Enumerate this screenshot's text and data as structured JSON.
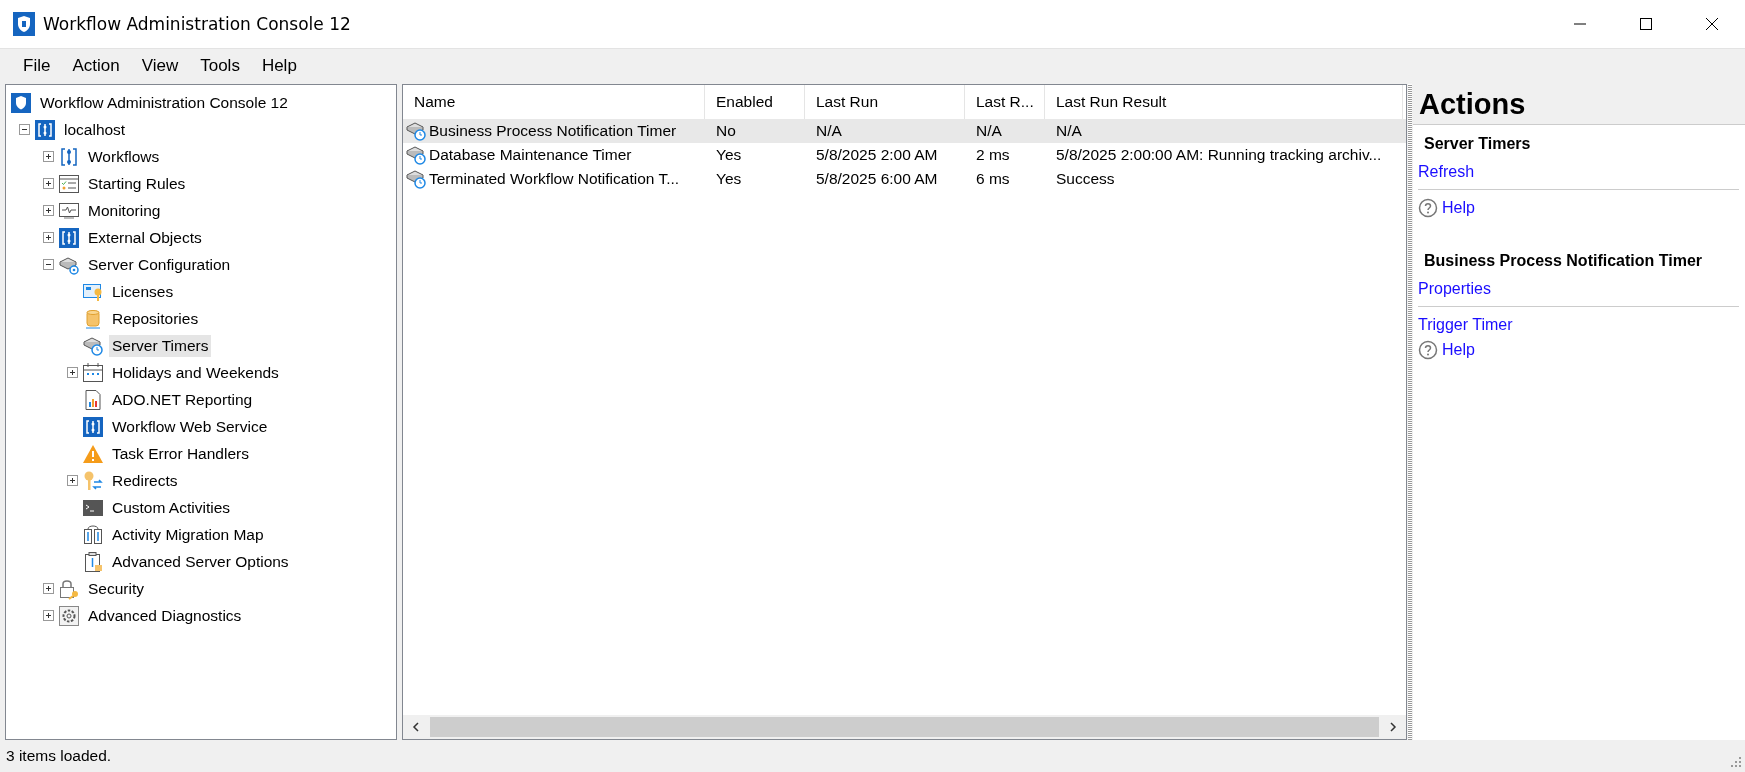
{
  "window": {
    "title": "Workflow Administration Console 12"
  },
  "menu": [
    "File",
    "Action",
    "View",
    "Tools",
    "Help"
  ],
  "tree": [
    {
      "label": "Workflow Administration Console 12",
      "kind": "app",
      "selected": false,
      "children": [
        {
          "label": "localhost",
          "kind": "server",
          "selected": false,
          "expanded": true,
          "children": [
            {
              "label": "Workflows",
              "kind": "workflow",
              "selected": false,
              "expanded": false
            },
            {
              "label": "Starting Rules",
              "kind": "rules",
              "selected": false,
              "expanded": false
            },
            {
              "label": "Monitoring",
              "kind": "monitor",
              "selected": false,
              "expanded": false
            },
            {
              "label": "External Objects",
              "kind": "server",
              "selected": false,
              "expanded": false
            },
            {
              "label": "Server Configuration",
              "kind": "config",
              "selected": false,
              "expanded": true,
              "children": [
                {
                  "label": "Licenses",
                  "kind": "license",
                  "selected": false
                },
                {
                  "label": "Repositories",
                  "kind": "database",
                  "selected": false
                },
                {
                  "label": "Server Timers",
                  "kind": "timer",
                  "selected": true
                },
                {
                  "label": "Holidays and Weekends",
                  "kind": "calendar",
                  "selected": false,
                  "expanded": false
                },
                {
                  "label": "ADO.NET Reporting",
                  "kind": "report",
                  "selected": false
                },
                {
                  "label": "Workflow Web Service",
                  "kind": "server",
                  "selected": false
                },
                {
                  "label": "Task Error Handlers",
                  "kind": "warning",
                  "selected": false
                },
                {
                  "label": "Redirects",
                  "kind": "redirect",
                  "selected": false,
                  "expanded": false
                },
                {
                  "label": "Custom Activities",
                  "kind": "terminal",
                  "selected": false
                },
                {
                  "label": "Activity Migration Map",
                  "kind": "map",
                  "selected": false
                },
                {
                  "label": "Advanced Server Options",
                  "kind": "options",
                  "selected": false
                }
              ]
            },
            {
              "label": "Security",
              "kind": "lock",
              "selected": false,
              "expanded": false
            },
            {
              "label": "Advanced Diagnostics",
              "kind": "gear",
              "selected": false,
              "expanded": false
            }
          ]
        }
      ]
    }
  ],
  "table": {
    "columns": [
      "Name",
      "Enabled",
      "Last Run",
      "Last R...",
      "Last Run Result"
    ],
    "rows": [
      {
        "selected": true,
        "cells": [
          "Business Process Notification Timer",
          "No",
          "N/A",
          "N/A",
          "N/A"
        ]
      },
      {
        "selected": false,
        "cells": [
          "Database Maintenance Timer",
          "Yes",
          "5/8/2025 2:00 AM",
          "2 ms",
          "5/8/2025 2:00:00 AM: Running tracking archiv..."
        ]
      },
      {
        "selected": false,
        "cells": [
          "Terminated Workflow Notification T...",
          "Yes",
          "5/8/2025 6:00 AM",
          "6 ms",
          "Success"
        ]
      }
    ]
  },
  "actions": {
    "title": "Actions",
    "sections": [
      {
        "title": "Server Timers",
        "items": [
          {
            "kind": "link",
            "label": "Refresh"
          },
          {
            "kind": "separator"
          },
          {
            "kind": "help",
            "label": "Help"
          }
        ]
      },
      {
        "title": "Business Process Notification Timer",
        "items": [
          {
            "kind": "link",
            "label": "Properties"
          },
          {
            "kind": "separator"
          },
          {
            "kind": "link",
            "label": "Trigger Timer"
          },
          {
            "kind": "help",
            "label": "Help"
          }
        ]
      }
    ]
  },
  "status_bar": "3 items loaded."
}
